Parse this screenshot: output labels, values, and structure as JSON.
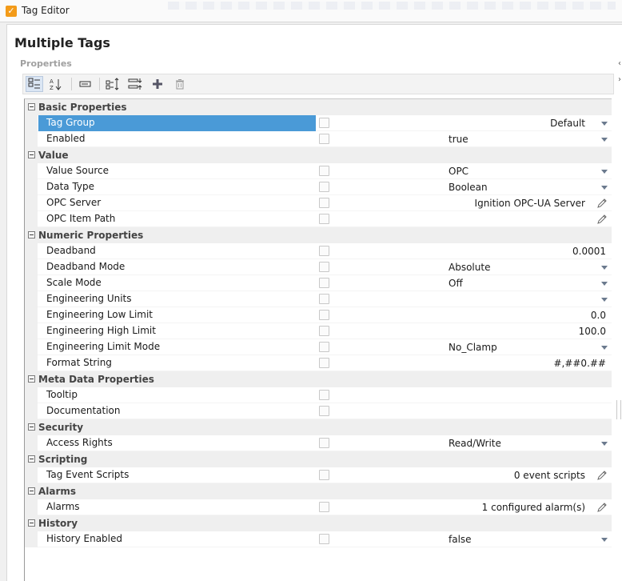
{
  "window": {
    "title": "Tag Editor",
    "app_icon": "ignition-check-icon",
    "accent": "#f39b19"
  },
  "page": {
    "title": "Multiple Tags",
    "section_label": "Properties"
  },
  "toolbar": {
    "buttons": [
      {
        "name": "categorized-view-button",
        "icon": "categorized-list-icon",
        "active": true
      },
      {
        "name": "alphabetical-sort-button",
        "icon": "sort-az-icon",
        "active": false
      },
      {
        "name": "toggle-description-button",
        "icon": "description-box-icon",
        "active": false
      },
      {
        "name": "expand-all-button",
        "icon": "expand-all-icon",
        "active": false
      },
      {
        "name": "collapse-all-button",
        "icon": "collapse-all-icon",
        "active": false
      },
      {
        "name": "add-property-button",
        "icon": "plus-icon",
        "active": false
      },
      {
        "name": "delete-property-button",
        "icon": "trash-icon",
        "active": false
      }
    ]
  },
  "selection_color": "#4a9ad7",
  "groups": [
    {
      "label": "Basic Properties",
      "rows": [
        {
          "name": "Tag Group",
          "value": "Default",
          "align": "right",
          "editor": "dropdown",
          "selected": true
        },
        {
          "name": "Enabled",
          "value": "true",
          "align": "left",
          "editor": "dropdown"
        }
      ]
    },
    {
      "label": "Value",
      "rows": [
        {
          "name": "Value Source",
          "value": "OPC",
          "align": "left",
          "editor": "dropdown"
        },
        {
          "name": "Data Type",
          "value": "Boolean",
          "align": "left",
          "editor": "dropdown"
        },
        {
          "name": "OPC Server",
          "value": "Ignition OPC-UA Server",
          "align": "right",
          "editor": "edit"
        },
        {
          "name": "OPC Item Path",
          "value": "",
          "align": "right",
          "editor": "edit"
        }
      ]
    },
    {
      "label": "Numeric Properties",
      "rows": [
        {
          "name": "Deadband",
          "value": "0.0001",
          "align": "right",
          "editor": "none"
        },
        {
          "name": "Deadband Mode",
          "value": "Absolute",
          "align": "left",
          "editor": "dropdown"
        },
        {
          "name": "Scale Mode",
          "value": "Off",
          "align": "left",
          "editor": "dropdown"
        },
        {
          "name": "Engineering Units",
          "value": "",
          "align": "left",
          "editor": "dropdown"
        },
        {
          "name": "Engineering Low Limit",
          "value": "0.0",
          "align": "right",
          "editor": "none"
        },
        {
          "name": "Engineering High Limit",
          "value": "100.0",
          "align": "right",
          "editor": "none"
        },
        {
          "name": "Engineering Limit Mode",
          "value": "No_Clamp",
          "align": "left",
          "editor": "dropdown"
        },
        {
          "name": "Format String",
          "value": "#,##0.##",
          "align": "right",
          "editor": "none"
        }
      ]
    },
    {
      "label": "Meta Data Properties",
      "rows": [
        {
          "name": "Tooltip",
          "value": "",
          "align": "right",
          "editor": "none"
        },
        {
          "name": "Documentation",
          "value": "",
          "align": "right",
          "editor": "none"
        }
      ]
    },
    {
      "label": "Security",
      "rows": [
        {
          "name": "Access Rights",
          "value": "Read/Write",
          "align": "left",
          "editor": "dropdown"
        }
      ]
    },
    {
      "label": "Scripting",
      "rows": [
        {
          "name": "Tag Event Scripts",
          "value": "0 event scripts",
          "align": "right",
          "editor": "edit"
        }
      ]
    },
    {
      "label": "Alarms",
      "rows": [
        {
          "name": "Alarms",
          "value": "1 configured alarm(s)",
          "align": "right",
          "editor": "edit"
        }
      ]
    },
    {
      "label": "History",
      "rows": [
        {
          "name": "History Enabled",
          "value": "false",
          "align": "left",
          "editor": "dropdown"
        }
      ]
    }
  ]
}
